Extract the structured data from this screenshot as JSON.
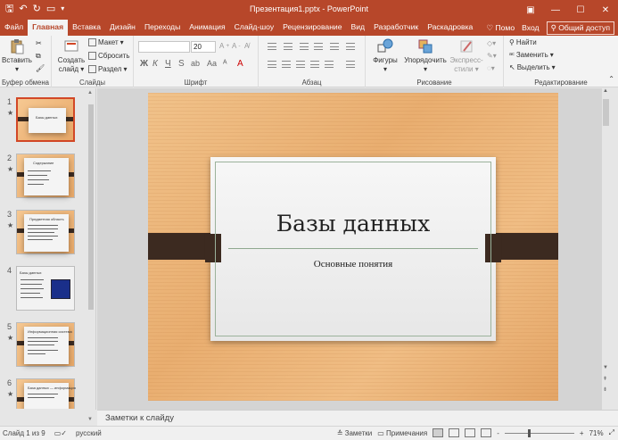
{
  "titlebar": {
    "title": "Презентация1.pptx - PowerPoint",
    "qat": [
      "save-icon",
      "undo-icon",
      "redo-icon",
      "start-slideshow-icon",
      "customize-icon"
    ],
    "winbtns": [
      "ribbon-options-icon",
      "minimize-icon",
      "maximize-icon",
      "close-icon"
    ]
  },
  "tabs": [
    "Файл",
    "Главная",
    "Вставка",
    "Дизайн",
    "Переходы",
    "Анимация",
    "Слайд-шоу",
    "Рецензирование",
    "Вид",
    "Разработчик",
    "Раскадровка"
  ],
  "active_tab": "Главная",
  "tabbar_right": {
    "help": "Помо",
    "login": "Вход",
    "share": "Общий доступ"
  },
  "ribbon": {
    "clipboard": {
      "label": "Буфер обмена",
      "paste": "Вставить"
    },
    "slides": {
      "label": "Слайды",
      "new_slide": "Создать",
      "new_slide2": "слайд",
      "layout": "Макет",
      "reset": "Сбросить",
      "section": "Раздел"
    },
    "font": {
      "label": "Шрифт",
      "font_name": "",
      "size": "20",
      "bold": "Ж",
      "italic": "К",
      "underline": "Ч",
      "strike": "S"
    },
    "paragraph": {
      "label": "Абзац"
    },
    "drawing": {
      "label": "Рисование",
      "shapes": "Фигуры",
      "arrange": "Упорядочить",
      "quick_styles": "Экспресс-",
      "quick_styles2": "стили"
    },
    "editing": {
      "label": "Редактирование",
      "find": "Найти",
      "replace": "Заменить",
      "select": "Выделить"
    }
  },
  "thumbnails": [
    {
      "num": "1",
      "title": "Базы данных",
      "selected": true
    },
    {
      "num": "2",
      "title": "Содержание",
      "selected": false
    },
    {
      "num": "3",
      "title": "Предметная область",
      "selected": false
    },
    {
      "num": "4",
      "title": "Базы данных",
      "selected": false
    },
    {
      "num": "5",
      "title": "Информационная система",
      "selected": false
    },
    {
      "num": "6",
      "title": "База данных — информация",
      "selected": false
    }
  ],
  "slide": {
    "title": "Базы данных",
    "subtitle": "Основные понятия"
  },
  "notes": {
    "placeholder": "Заметки к слайду"
  },
  "status": {
    "slide_counter": "Слайд 1 из 9",
    "language": "русский",
    "notes_btn": "Заметки",
    "comments_btn": "Примечания",
    "zoom_minus": "-",
    "zoom_plus": "+",
    "zoom": "71%",
    "zoom_value_percent": 71
  }
}
